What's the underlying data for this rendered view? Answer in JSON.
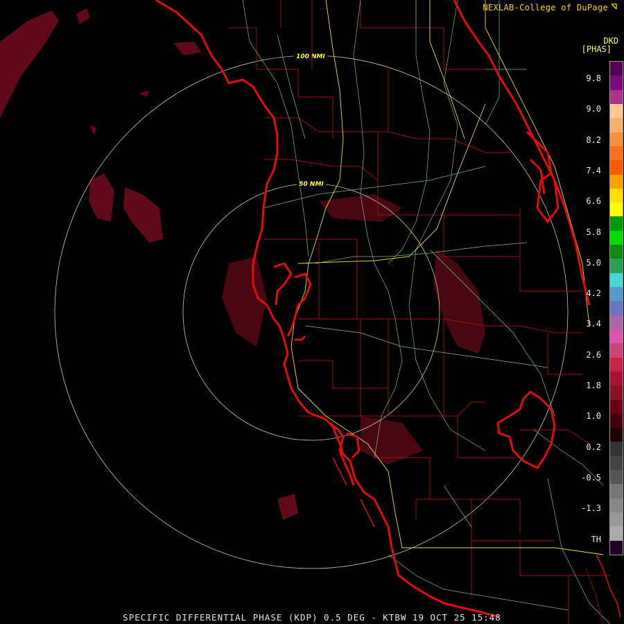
{
  "credit": "NEXLAB-College of DuPage",
  "credit_icon": "cursor-icon",
  "legend": {
    "units_top": "DKD",
    "units": "[PHAS]",
    "labels": [
      "9.8",
      "9.0",
      "8.2",
      "7.4",
      "6.6",
      "5.8",
      "5.0",
      "4.2",
      "3.4",
      "2.6",
      "1.8",
      "1.0",
      "0.2",
      "-0.5",
      "-1.3",
      "TH"
    ],
    "colors": [
      "#550055",
      "#7a0a7a",
      "#aa3388",
      "#ffc896",
      "#f8b070",
      "#f89040",
      "#f87020",
      "#f85800",
      "#f8a000",
      "#ffe000",
      "#ffff00",
      "#009900",
      "#00dd00",
      "#118811",
      "#2aa050",
      "#44d8d8",
      "#5599cc",
      "#6677bb",
      "#aa66aa",
      "#dd55aa",
      "#cc4477",
      "#cc2244",
      "#aa1133",
      "#881122",
      "#660011",
      "#440008",
      "#220000",
      "#333333",
      "#444444",
      "#555555",
      "#777777",
      "#888888",
      "#999999",
      "#aaaaaa",
      "#220022"
    ]
  },
  "rings": [
    {
      "label": "100 NMI"
    },
    {
      "label": "50 NMI"
    }
  ],
  "footer": "SPECIFIC DIFFERENTIAL PHASE (KDP) 0.5 DEG - KTBW 19 OCT 25 15:48"
}
